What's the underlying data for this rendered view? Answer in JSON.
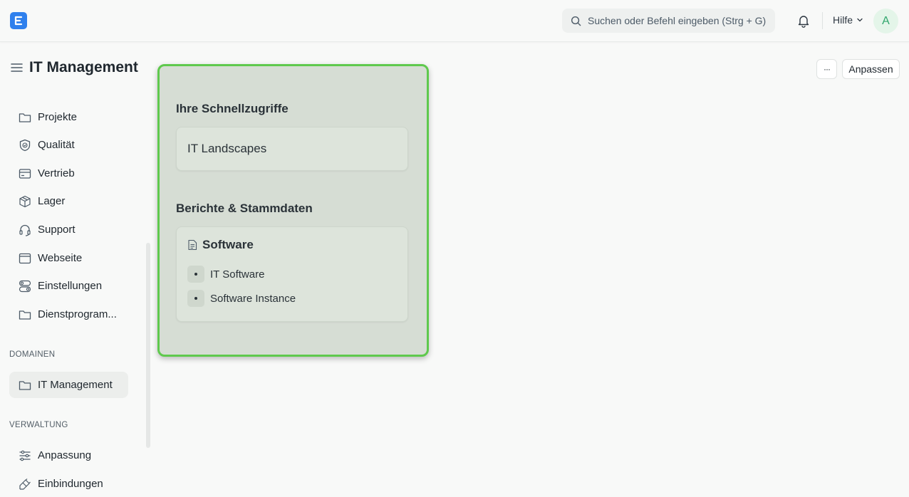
{
  "navbar": {
    "search_placeholder": "Suchen oder Befehl eingeben (Strg + G)",
    "help_label": "Hilfe",
    "avatar_initial": "A",
    "logo_icon": "e-logo-icon",
    "accent_color": "#2f80ed"
  },
  "page": {
    "title": "IT Management",
    "more_label": "···",
    "customize_label": "Anpassen"
  },
  "sidebar": {
    "items": [
      {
        "label": "Projekte",
        "icon": "folder-icon"
      },
      {
        "label": "Qualität",
        "icon": "shield-check-icon"
      },
      {
        "label": "Vertrieb",
        "icon": "card-icon"
      },
      {
        "label": "Lager",
        "icon": "box-icon"
      },
      {
        "label": "Support",
        "icon": "headset-icon"
      },
      {
        "label": "Webseite",
        "icon": "browser-icon"
      },
      {
        "label": "Einstellungen",
        "icon": "toggles-icon"
      },
      {
        "label": "Dienstprogram...",
        "icon": "folder-icon"
      }
    ],
    "domains_heading": "DOMAINEN",
    "domains": [
      {
        "label": "IT Management",
        "icon": "folder-icon",
        "active": true
      }
    ],
    "admin_heading": "VERWALTUNG",
    "admin": [
      {
        "label": "Anpassung",
        "icon": "sliders-icon"
      },
      {
        "label": "Einbindungen",
        "icon": "plug-icon"
      }
    ]
  },
  "workspace": {
    "shortcuts_heading": "Ihre Schnellzugriffe",
    "shortcuts": [
      {
        "label": "IT Landscapes"
      }
    ],
    "reports_heading": "Berichte & Stammdaten",
    "report_card": {
      "title": "Software",
      "icon": "document-icon",
      "links": [
        {
          "label": "IT Software"
        },
        {
          "label": "Software Instance"
        }
      ]
    },
    "highlight_color": "#5fc94d"
  }
}
